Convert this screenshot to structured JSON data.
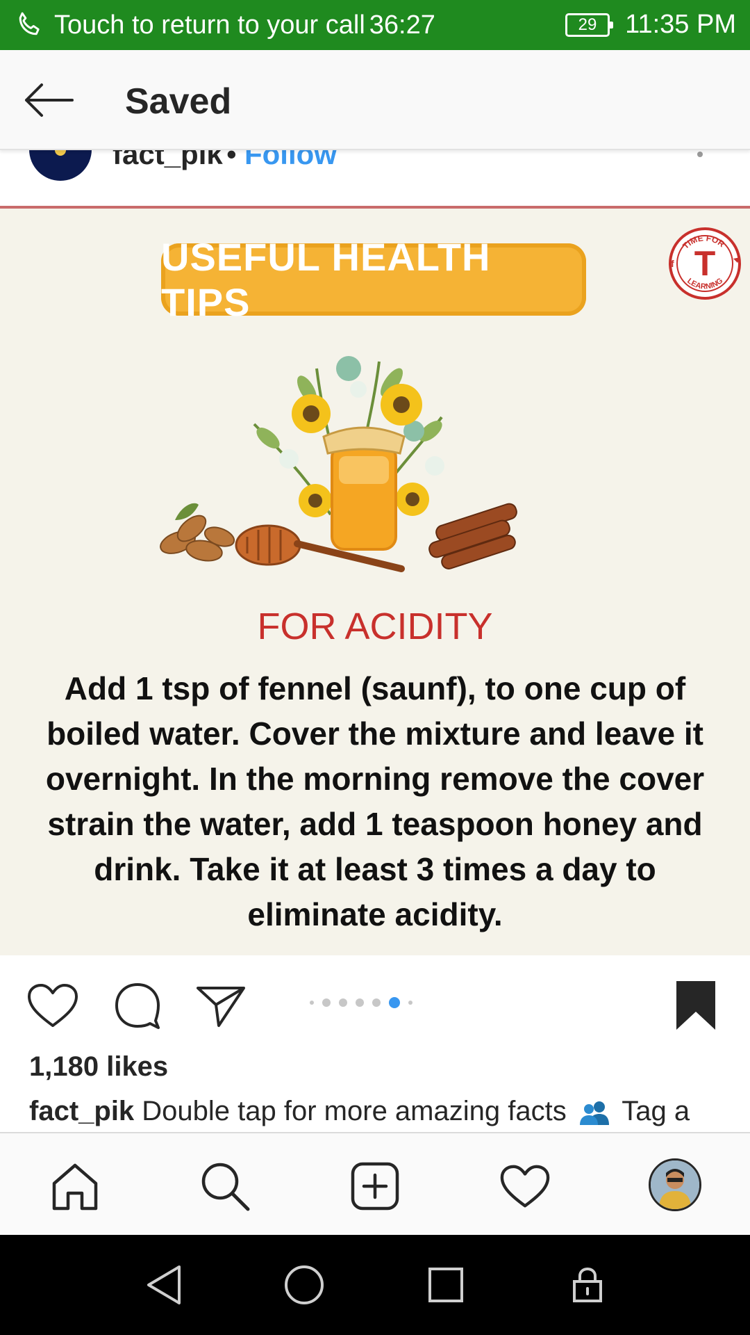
{
  "status_bar": {
    "call_text": "Touch to return to your call",
    "call_timer": "36:27",
    "battery": "29",
    "clock": "11:35 PM"
  },
  "header": {
    "title": "Saved"
  },
  "post": {
    "username": "fact_pik",
    "separator": "•",
    "follow_label": "Follow",
    "image": {
      "banner": "USEFUL HEALTH TIPS",
      "logo_top_text": "TIME FOR",
      "logo_letter": "T",
      "logo_bottom_text": "LEARNING",
      "heading": "FOR ACIDITY",
      "body_lines": [
        "Add 1 tsp of fennel (saunf), to one cup of",
        "boiled water. Cover the mixture and leave it",
        "overnight. In the morning remove the cover",
        "strain the water, add 1 teaspoon honey and",
        "drink. Take it at least 3 times a day to",
        "eliminate acidity."
      ]
    },
    "carousel": {
      "total_dots": 7,
      "active_index": 5
    },
    "likes": "1,180 likes",
    "caption": {
      "user": "fact_pik",
      "text": "Double tap for more amazing facts",
      "text_after_icon": "Tag a"
    }
  },
  "colors": {
    "status_bar_green": "#1f8a1f",
    "link_blue": "#3897f0",
    "heading_red": "#c8302c",
    "banner_orange": "#f5b335"
  },
  "icons": {
    "status": "phone-icon",
    "header": "back-arrow-icon",
    "actions": [
      "heart-icon",
      "comment-icon",
      "share-icon",
      "bookmark-icon"
    ],
    "bottom_nav": [
      "home-icon",
      "search-icon",
      "add-post-icon",
      "activity-heart-icon",
      "profile-avatar"
    ],
    "system_nav": [
      "back-triangle-icon",
      "home-circle-icon",
      "recents-square-icon",
      "lock-icon"
    ]
  }
}
